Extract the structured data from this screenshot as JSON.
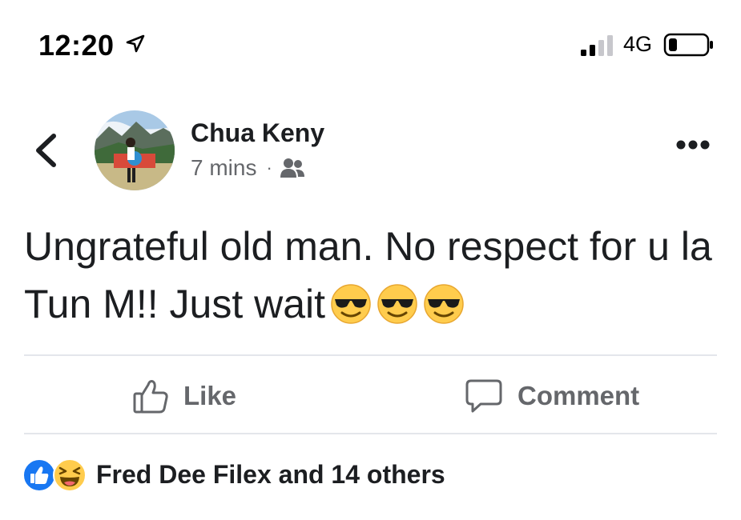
{
  "status_bar": {
    "time": "12:20",
    "network": "4G",
    "icons": [
      "location-arrow-icon",
      "cellular-signal-icon",
      "battery-icon"
    ]
  },
  "post": {
    "author": "Chua Keny",
    "time_ago": "7 mins",
    "separator": "·",
    "audience_icon": "friends-icon",
    "text": "Ungrateful old man. No respect for u la Tun M!! Just wait",
    "emojis": [
      "smiling-face-with-sunglasses",
      "smiling-face-with-sunglasses",
      "smiling-face-with-sunglasses"
    ]
  },
  "actions": {
    "like_label": "Like",
    "comment_label": "Comment"
  },
  "reactions": {
    "summary": "Fred Dee Filex and 14 others",
    "icons": [
      "like-reaction-icon",
      "haha-reaction-icon"
    ]
  },
  "colors": {
    "text_primary": "#1c1e21",
    "text_secondary": "#65676b",
    "divider": "#e4e6eb",
    "like_blue": "#1877f2",
    "emoji_yellow": "#ffcc4d"
  }
}
